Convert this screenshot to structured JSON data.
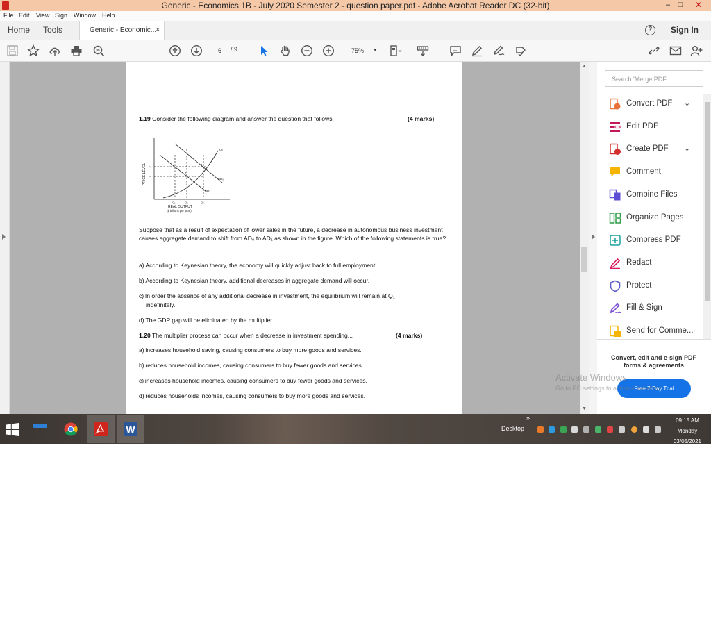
{
  "window": {
    "title": "Generic - Economics 1B - July 2020 Semester 2 - question paper.pdf - Adobe Acrobat Reader DC (32-bit)",
    "controls": {
      "minimize": "–",
      "maximize": "□",
      "close": "✕"
    }
  },
  "menu": [
    "File",
    "Edit",
    "View",
    "Sign",
    "Window",
    "Help"
  ],
  "tabs": {
    "home": "Home",
    "tools": "Tools",
    "document": "Generic - Economic...",
    "close": "×",
    "sign_in": "Sign In",
    "help": "?"
  },
  "toolbar": {
    "page_current": "6",
    "page_total": "/ 9",
    "zoom": "75%",
    "zoom_arrow": "▾",
    "icons": [
      "save-icon",
      "bookmark-star-icon",
      "upload-cloud-icon",
      "print-icon",
      "zoom-search-icon",
      "page-up-icon",
      "page-down-icon",
      "select-arrow-icon",
      "hand-icon",
      "zoom-out-icon",
      "zoom-in-icon",
      "page-fit-icon",
      "scroll-mode-icon",
      "comment-icon",
      "highlight-pen-icon",
      "sign-icon",
      "more-tools-icon",
      "link-icon",
      "email-icon",
      "add-user-icon"
    ]
  },
  "document": {
    "q19_num": "1.19",
    "q19_text": "Consider the following diagram and answer the question that follows.",
    "q19_marks": "(4 marks)",
    "diagram": {
      "y_label": "PRICE LEVEL",
      "x_label": "REAL OUTPUT",
      "x_label2": "($ billions per year)",
      "as": "AS",
      "ad0": "AD₀",
      "ad1": "AD₁",
      "p0": "P₀",
      "p1": "P₁",
      "q1": "Q₁",
      "q0": "Q₀",
      "q2": "Q₂",
      "a": "a",
      "b": "b"
    },
    "para_text": "Suppose that as a result of expectation of lower sales in the future, a decrease in autonomous business investment causes aggregate demand to shift from AD₀ to AD₁ as shown in the figure. Which of the following statements is true?",
    "options19": [
      "a) According to Keynesian theory, the economy will quickly adjust back to full employment.",
      "b) According to Keynesian theory, additional decreases in aggregate demand will occur.",
      "c) In order the absence of any additional decrease in investment, the equilibrium will remain at Q₁",
      "indefinitely.",
      "d) The GDP gap will be eliminated by the multiplier."
    ],
    "q20_num": "1.20",
    "q20_text": "The multiplier process can occur when a decrease in investment spending...",
    "q20_marks": "(4 marks)",
    "options20": [
      "a) increases household saving, causing consumers to buy more goods and services.",
      "b) reduces household incomes, causing consumers to buy fewer goods and services.",
      "c) increases household incomes, causing consumers to buy fewer goods and services.",
      "d) reduces households incomes, causing consumers to buy more goods and services."
    ]
  },
  "right_panel": {
    "search_placeholder": "Search 'Merge PDF'",
    "tools": [
      {
        "label": "Convert PDF",
        "icon": "convert-pdf-icon",
        "chevron": "⌄",
        "color": "#e8743b"
      },
      {
        "label": "Edit PDF",
        "icon": "edit-pdf-icon",
        "color": "#c2185b"
      },
      {
        "label": "Create PDF",
        "icon": "create-pdf-icon",
        "chevron": "⌄",
        "color": "#d32f2f"
      },
      {
        "label": "Comment",
        "icon": "comment-icon",
        "color": "#f4b400"
      },
      {
        "label": "Combine Files",
        "icon": "combine-files-icon",
        "color": "#5c4fd6"
      },
      {
        "label": "Organize Pages",
        "icon": "organize-pages-icon",
        "color": "#2e9c47"
      },
      {
        "label": "Compress PDF",
        "icon": "compress-pdf-icon",
        "color": "#1aa0a0"
      },
      {
        "label": "Redact",
        "icon": "redact-icon",
        "color": "#d81b60"
      },
      {
        "label": "Protect",
        "icon": "protect-icon",
        "color": "#5b5fc7"
      },
      {
        "label": "Fill & Sign",
        "icon": "fill-sign-icon",
        "color": "#7b4fd6"
      },
      {
        "label": "Send for Comme...",
        "icon": "send-for-comment-icon",
        "color": "#f4b400"
      }
    ],
    "promo": "Convert, edit and e-sign PDF forms & agreements",
    "trial_button": "Free 7-Day Trial",
    "watermark": "Activate Windows",
    "watermark_sub": "Go to PC settings to activate Windows."
  },
  "taskbar": {
    "desktop": "Desktop",
    "chevron": "»",
    "time": "09:15 AM",
    "day": "Monday",
    "date": "03/05/2021",
    "apps": [
      "start-windows-icon",
      "news-app-icon",
      "chrome-icon",
      "acrobat-icon",
      "word-icon"
    ]
  },
  "colors": {
    "acrobat_red": "#d0251c",
    "accent_blue": "#1473e6",
    "titlebar": "#f5c9a8"
  }
}
